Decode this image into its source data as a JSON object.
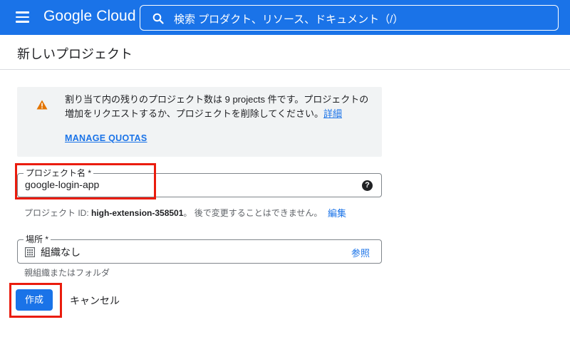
{
  "app": {
    "logo": "Google Cloud"
  },
  "search": {
    "placeholder": "検索  プロダクト、リソース、ドキュメント（/）"
  },
  "page": {
    "title": "新しいプロジェクト"
  },
  "banner": {
    "text_line1": "割り当て内の残りのプロジェクト数は 9 projects 件です。プロジェクトの",
    "text_line2": "増加をリクエストするか、プロジェクトを削除してください。",
    "details_link": "詳細",
    "manage_quotas": "MANAGE QUOTAS"
  },
  "project_name": {
    "label": "プロジェクト名 *",
    "value": "google-login-app",
    "help": "?"
  },
  "project_id_hint": {
    "prefix": "プロジェクト ID: ",
    "id": "high-extension-358501",
    "suffix": "。 後で変更することはできません。",
    "edit_link": "編集"
  },
  "location": {
    "label": "場所 *",
    "value": "組織なし",
    "browse": "参照",
    "hint": "親組織またはフォルダ"
  },
  "actions": {
    "create": "作成",
    "cancel": "キャンセル"
  },
  "colors": {
    "accent": "#1a73e8",
    "warning": "#e37400",
    "highlight": "#ea1c0d"
  },
  "icons": [
    "menu-icon",
    "search-icon",
    "warning-icon",
    "help-icon",
    "building-icon"
  ]
}
